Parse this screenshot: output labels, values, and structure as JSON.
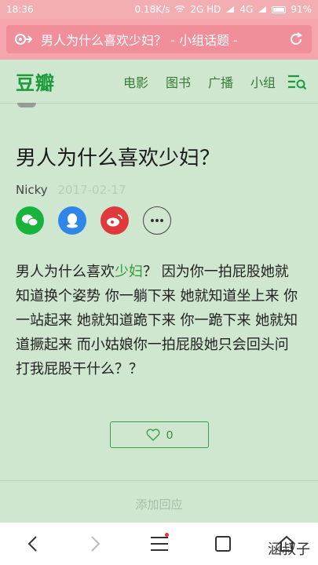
{
  "status": {
    "time": "18:36",
    "speed": "0.18K/s",
    "network": "2G HD",
    "network2": "4G",
    "battery": "91%"
  },
  "address": {
    "title": "男人为什么喜欢少妇？ - 小组话题 -"
  },
  "nav": {
    "logo": "豆瓣",
    "links": [
      "电影",
      "图书",
      "广播",
      "小组"
    ]
  },
  "post": {
    "title": "男人为什么喜欢少妇？",
    "author": "Nicky",
    "date": "2017-02-17",
    "body_pre": "男人为什么喜欢",
    "body_highlight": "少妇",
    "body_post": "？ 因为你一拍屁股她就知道换个姿势 你一躺下来 她就知道坐上来 你一站起来 她就知道跪下来 你一跪下来 她就知道撅起来 而小姑娘你一拍屁股她只会回头问打我屁股干什么？？",
    "likes": "0",
    "reply_label": "添加回应"
  },
  "share_icons": [
    "wechat-icon",
    "qq-icon",
    "weibo-icon",
    "more-icon"
  ],
  "bottom": {
    "watermark": "涵叔子"
  },
  "colors": {
    "accent": "#1a9c3a",
    "topbar": "#f5a6ad",
    "background": "#cfe6cf"
  }
}
